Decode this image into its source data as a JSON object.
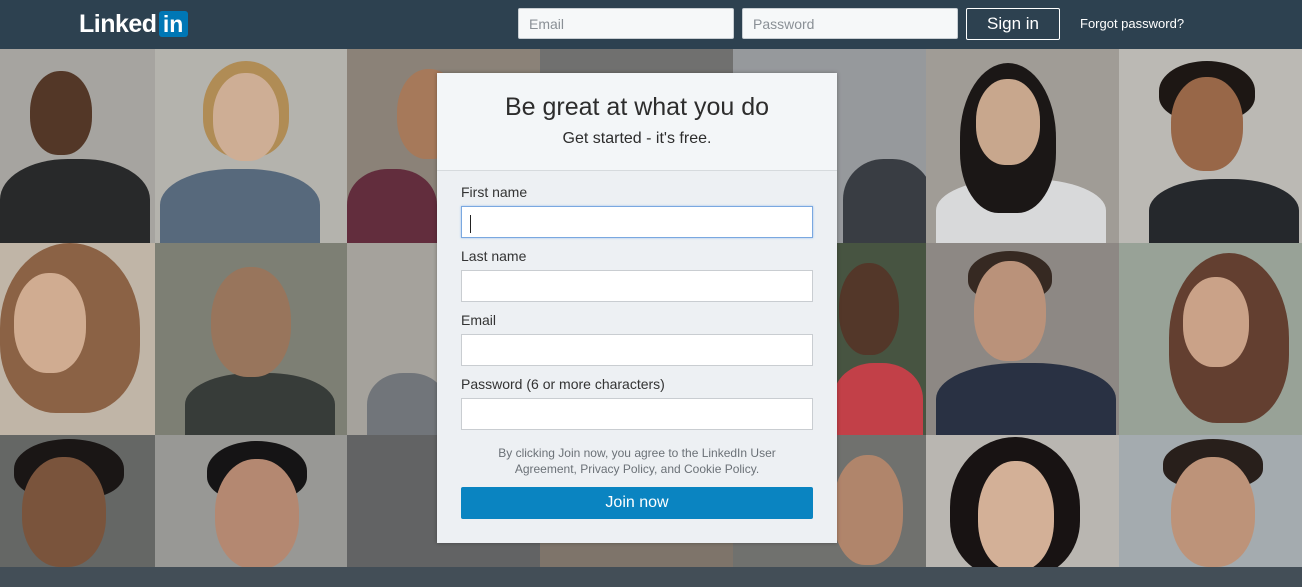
{
  "header": {
    "logo_text": "Linked",
    "logo_box": "in",
    "email_placeholder": "Email",
    "password_placeholder": "Password",
    "signin_label": "Sign in",
    "forgot_label": "Forgot password?"
  },
  "card": {
    "title": "Be great at what you do",
    "subtitle": "Get started - it's free.",
    "fields": [
      {
        "label": "First name",
        "value": ""
      },
      {
        "label": "Last name",
        "value": ""
      },
      {
        "label": "Email",
        "value": ""
      },
      {
        "label": "Password (6 or more characters)",
        "value": ""
      }
    ],
    "terms": "By clicking Join now, you agree to the LinkedIn User Agreement, Privacy Policy, and Cookie Policy.",
    "join_label": "Join now"
  },
  "colors": {
    "header_bg": "#2d4150",
    "brand_blue": "#0077b5",
    "join_button": "#0a84c1"
  }
}
